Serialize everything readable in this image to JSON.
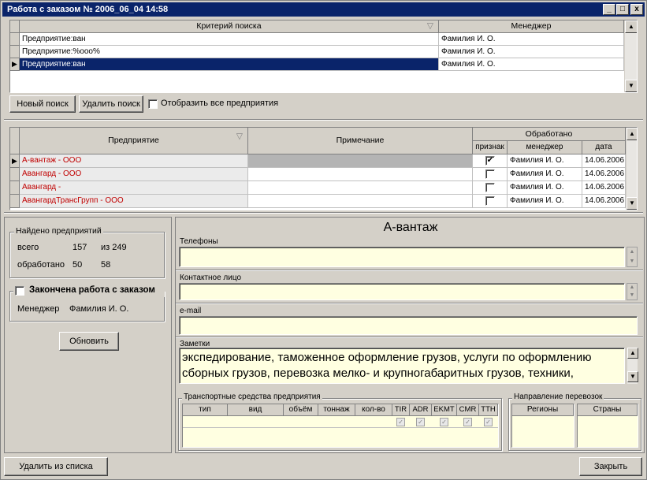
{
  "window": {
    "title": "Работа с заказом № 2006_06_04 14:58",
    "min_label": "_",
    "max_label": "□",
    "close_label": "x"
  },
  "search_grid": {
    "col_criteria": "Критерий поиска",
    "col_manager": "Менеджер",
    "rows": [
      {
        "criteria": "Предприятие:ван",
        "manager": "Фамилия И. О."
      },
      {
        "criteria": "Предприятие:%ооо%",
        "manager": "Фамилия И. О."
      },
      {
        "criteria": "Предприятие:ван",
        "manager": "Фамилия И. О."
      }
    ]
  },
  "search_buttons": {
    "new_search": "Новый поиск",
    "delete_search": "Удалить поиск",
    "show_all": "Отобразить все предприятия"
  },
  "company_grid": {
    "col_company": "Предприятие",
    "col_note": "Примечание",
    "col_processed": "Обработано",
    "col_sign": "признак",
    "col_manager": "менеджер",
    "col_date": "дата",
    "rows": [
      {
        "company": "А-вантаж - ООО",
        "manager": "Фамилия И. О.",
        "date": "14.06.2006",
        "checked": "✔"
      },
      {
        "company": "Авангард - ООО",
        "manager": "Фамилия И. О.",
        "date": "14.06.2006",
        "checked": ""
      },
      {
        "company": "Авангард -",
        "manager": "Фамилия И. О.",
        "date": "14.06.2006",
        "checked": ""
      },
      {
        "company": "АвангардТрансГрупп - ООО",
        "manager": "Фамилия И. О.",
        "date": "14.06.2006",
        "checked": ""
      }
    ]
  },
  "stats": {
    "group_title": "Найдено предприятий",
    "total_label": "всего",
    "total_value": "157",
    "of_label": "из 249",
    "processed_label": "обработано",
    "processed_value": "50",
    "processed_of": "58"
  },
  "order_done": {
    "label": "Закончена работа с заказом",
    "manager_label": "Менеджер",
    "manager_value": "Фамилия И. О.",
    "refresh_button": "Обновить"
  },
  "details": {
    "company_title": "А-вантаж",
    "phones_label": "Телефоны",
    "phones_value": "",
    "contact_label": "Контактное лицо",
    "contact_value": "",
    "email_label": "e-mail",
    "email_value": "",
    "notes_label": "Заметки",
    "notes_value": "экспедирование, таможенное оформление грузов,  услуги по оформлению сборных грузов, перевозка мелко- и крупногабаритных грузов, техники,"
  },
  "transport": {
    "group_title": "Транспортные средства предприятия",
    "columns": [
      "тип",
      "вид",
      "объём",
      "тоннаж",
      "кол-во",
      "TIR",
      "ADR",
      "EKMT",
      "CMR",
      "TTH"
    ]
  },
  "direction": {
    "group_title": "Направление перевозок",
    "col_regions": "Регионы",
    "col_countries": "Страны"
  },
  "bottom": {
    "delete_button": "Удалить из списка",
    "close_button": "Закрыть"
  },
  "colors": {
    "title_bar": "#0a246a",
    "company_red": "#c00000",
    "note_field": "#ffffe1",
    "selection": "#0a246a"
  }
}
